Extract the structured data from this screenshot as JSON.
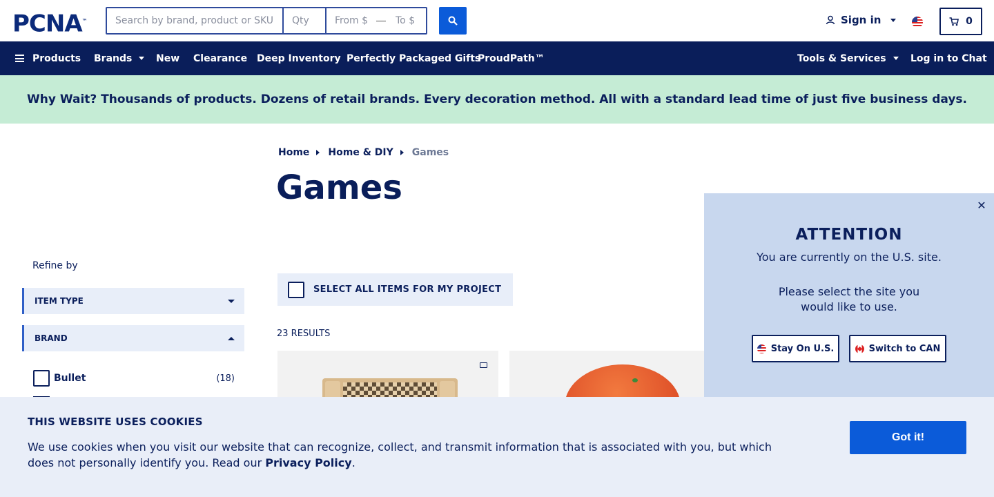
{
  "header": {
    "logo_text": "PCNA",
    "logo_tm": "™",
    "search_placeholder": "Search by brand, product or SKU",
    "qty_placeholder": "Qty",
    "from_placeholder": "From $",
    "to_placeholder": "To $",
    "sign_in": "Sign in",
    "cart_count": "0"
  },
  "nav": {
    "products": "Products",
    "brands": "Brands",
    "new": "New",
    "clearance": "Clearance",
    "deep_inventory": "Deep Inventory",
    "gifts": "Perfectly Packaged Gifts",
    "proudpath": "ProudPath™",
    "tools": "Tools & Services",
    "chat": "Log in to Chat"
  },
  "banner": "Why Wait? Thousands of products. Dozens of retail brands. Every decoration method. All with a standard lead time of just five business days.",
  "breadcrumb": {
    "home": "Home",
    "category": "Home & DIY",
    "current": "Games"
  },
  "page_title": "Games",
  "sidebar": {
    "refine_label": "Refine by",
    "facets": [
      {
        "label": "ITEM TYPE",
        "expanded": false
      },
      {
        "label": "BRAND",
        "expanded": true
      }
    ],
    "brands": [
      {
        "label": "Bullet",
        "count": "(18)"
      }
    ]
  },
  "listing": {
    "select_all": "SELECT ALL ITEMS FOR MY PROJECT",
    "results": "23 RESULTS"
  },
  "attention": {
    "title": "ATTENTION",
    "line1": "You are currently on the U.S. site.",
    "line2": "Please select the site you would like to use.",
    "stay_label": "Stay On U.S.",
    "switch_label": "Switch to CAN"
  },
  "cookie": {
    "title": "THIS WEBSITE USES COOKIES",
    "text": "We use cookies when you visit our website that can recognize, collect, and transmit information that is associated with you, but which does not personally identify you. Read our ",
    "link": "Privacy Policy",
    "period": ".",
    "button": "Got it!"
  },
  "colors": {
    "navy": "#0a1e5a",
    "accent_blue": "#0b5bd9",
    "banner_green": "#c5ecd5",
    "panel_blue": "#c8d7ee",
    "cookie_bg": "#e9eef8"
  }
}
